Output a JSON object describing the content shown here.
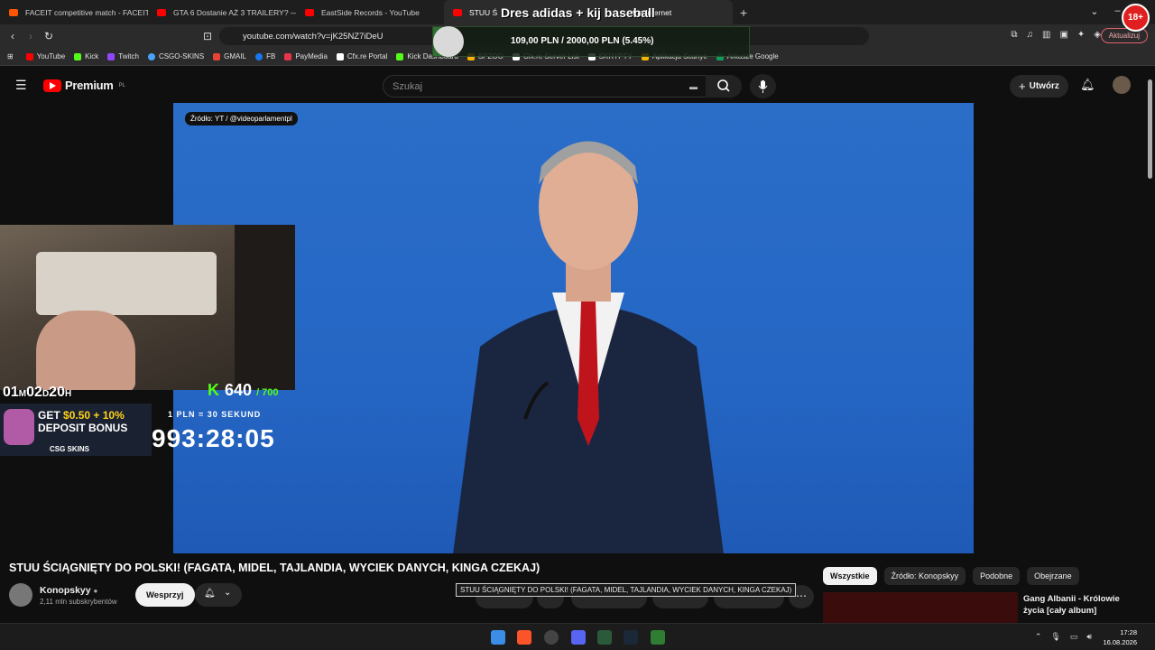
{
  "browser": {
    "tabs": [
      {
        "title": "FACEIT competitive match - FACEIT.c",
        "color": "#ff5500"
      },
      {
        "title": "GTA 6 Dostanie AŻ 3 TRAILERY? — R",
        "color": "#ff0000"
      },
      {
        "title": "EastSide Records - YouTube",
        "color": "#ff0000"
      },
      {
        "title": "STUU Ś",
        "color": "#ff0000"
      },
      {
        "title": "the Internet",
        "color": "#888888"
      }
    ],
    "url": "youtube.com/watch?v=jK25NZ7iDeU",
    "update_label": "Aktualizuj",
    "bookmarks": [
      {
        "label": "YouTube",
        "color": "#ff0000"
      },
      {
        "label": "Kick",
        "color": "#53fc18"
      },
      {
        "label": "Twitch",
        "color": "#9146ff"
      },
      {
        "label": "CSGO-SKINS",
        "color": "#4aa3ff"
      },
      {
        "label": "GMAIL",
        "color": "#ea4335"
      },
      {
        "label": "FB",
        "color": "#1877f2"
      },
      {
        "label": "PayMedia",
        "color": "#e8344d"
      },
      {
        "label": "Cfx.re Portal",
        "color": "#ffffff"
      },
      {
        "label": "Kick Dashboard",
        "color": "#53fc18"
      },
      {
        "label": "SPZOO",
        "color": "#ffb000"
      },
      {
        "label": "Cfx.re Server List",
        "color": "#ffffff"
      },
      {
        "label": "SKRYPTY",
        "color": "#ffffff"
      },
      {
        "label": "Aplikacja Scanye",
        "color": "#f4b400"
      },
      {
        "label": "Arkusze Google",
        "color": "#0f9d58"
      }
    ]
  },
  "stream_overlay": {
    "goal_title": "Dres adidas + kij baseball",
    "goal_amount": "109,00 PLN / 2000,00 PLN  (5.45%)",
    "goal_progress": 0.0545,
    "age_badge": "18+",
    "subathon_timer_parts": [
      "01",
      "M",
      "02",
      "D",
      "20",
      "H"
    ],
    "kick_count": "640",
    "kick_goal": "/ 700",
    "rate_text": "1 PLN = 30 SEKUND",
    "big_timer": "993:28:05",
    "promo_line1_prefix": "GET ",
    "promo_line1_highlight": "$0.50 + 10%",
    "promo_line2": "DEPOSIT BONUS",
    "promo_brand": "CSG SKINS"
  },
  "youtube": {
    "logo_text": "Premium",
    "logo_region": "PL",
    "search_placeholder": "Szukaj",
    "create_label": "Utwórz",
    "video_source_label": "Źródło: YT / @videoparlamentpl",
    "video_title": "STUU ŚCIĄGNIĘTY DO POLSKI! (FAGATA, MIDEL, TAJLANDIA, WYCIEK DANYCH, KINGA CZEKAJ)",
    "tooltip": "STUU ŚCIĄGNIĘTY DO POLSKI! (FAGATA, MIDEL, TAJLANDIA, WYCIEK DANYCH, KINGA CZEKAJ)",
    "channel_name": "Konopskyy",
    "channel_subs": "2,11 mln subskrybentów",
    "support_label": "Wesprzyj",
    "chips": [
      "Wszystkie",
      "Źródło: Konopskyy",
      "Podobne",
      "Obejrzane"
    ],
    "side_video_title": "Gang Albanii - Królowie życia [cały album]"
  },
  "taskbar": {
    "time": "17:28",
    "date": "16.08.2026"
  }
}
